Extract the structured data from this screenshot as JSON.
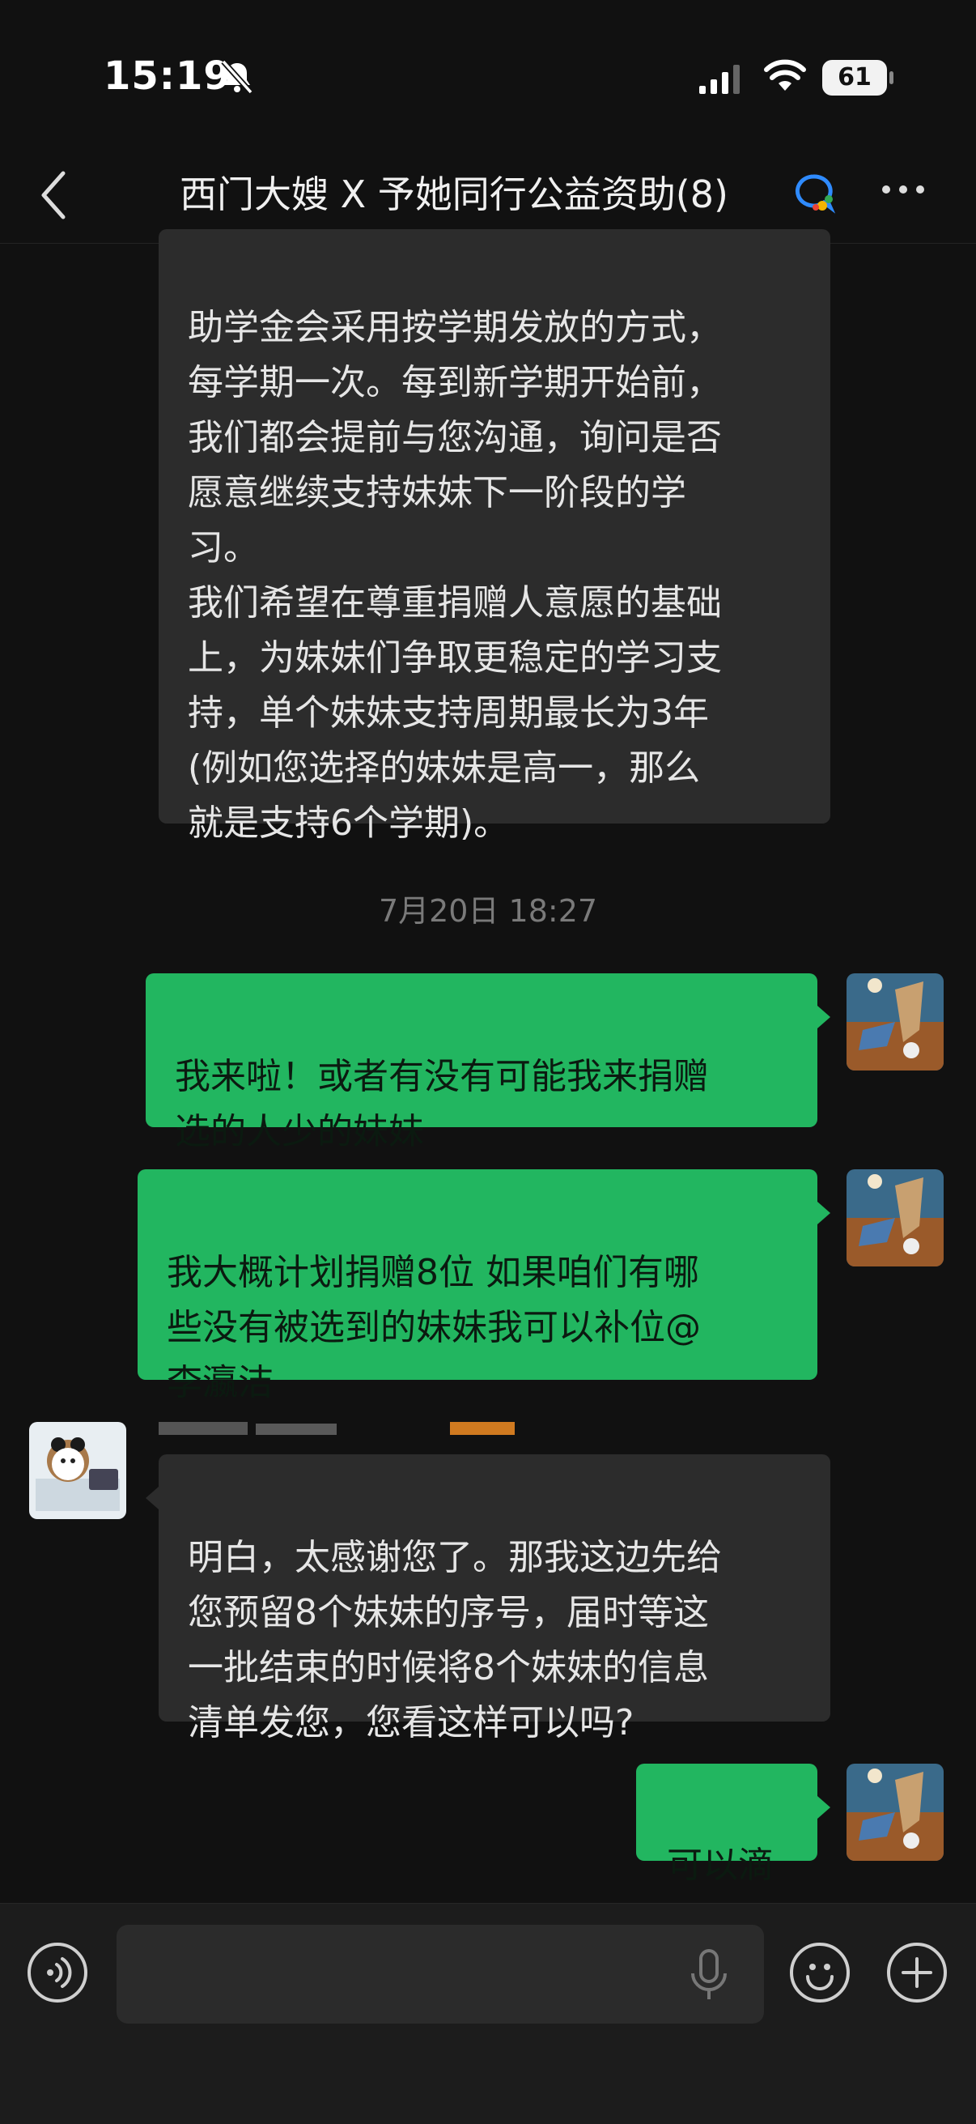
{
  "status_bar": {
    "time": "15:19",
    "battery": "61"
  },
  "nav": {
    "title": "西门大嫂 X 予她同行公益资助(8)"
  },
  "messages": {
    "m1": "助学金会采用按学期发放的方式，\n每学期一次。每到新学期开始前，\n我们都会提前与您沟通，询问是否\n愿意继续支持妹妹下一阶段的学\n习。\n我们希望在尊重捐赠人意愿的基础\n上，为妹妹们争取更稳定的学习支\n持，单个妹妹支持周期最长为3年\n(例如您选择的妹妹是高一，那么\n就是支持6个学期)。",
    "timestamp": "7月20日 18:27",
    "m2": "我来啦！或者有没有可能我来捐赠\n选的人少的妹妹",
    "m3": "我大概计划捐赠8位 如果咱们有哪\n些没有被选到的妹妹我可以补位@\n李瀛洁",
    "m4": "明白，太感谢您了。那我这边先给\n您预留8个妹妹的序号，届时等这\n一批结束的时候将8个妹妹的信息\n清单发您，您看这样可以吗?",
    "m5": "可以滴"
  },
  "input": {
    "placeholder": ""
  },
  "colors": {
    "background": "#111111",
    "outgoing_bubble": "#22b660",
    "incoming_bubble": "#2c2c2c"
  }
}
